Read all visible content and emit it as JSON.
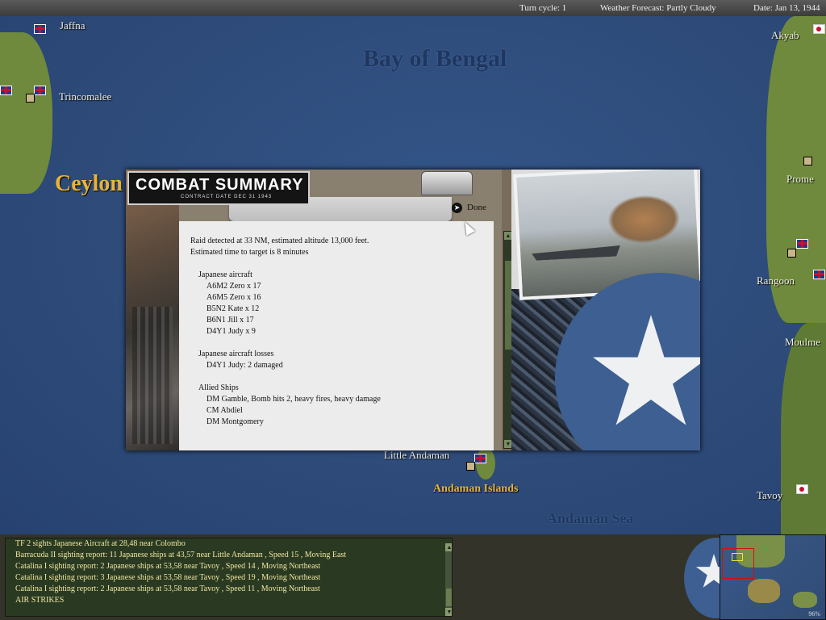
{
  "topbar": {
    "turn_cycle": "Turn cycle: 1",
    "weather": "Weather Forecast: Partly Cloudy",
    "date": "Date: Jan 13, 1944"
  },
  "map": {
    "sea_labels": {
      "bay_of_bengal": "Bay of Bengal",
      "andaman_sea": "Andaman Sea"
    },
    "places": {
      "jaffna": "Jaffna",
      "trincomalee": "Trincomalee",
      "ceylon": "Ceylon",
      "akyab": "Akyab",
      "prome": "Prome",
      "rangoon": "Rangoon",
      "moulmein": "Moulme",
      "tavoy": "Tavoy",
      "little_andaman": "Little Andaman",
      "andaman_islands": "Andaman Islands"
    }
  },
  "dialog": {
    "title": "COMBAT SUMMARY",
    "subtitle": "CONTRACT DATE DEC 31 1943",
    "done_label": "Done",
    "report": {
      "raid_line1": "Raid detected at 33 NM, estimated altitude 13,000 feet.",
      "raid_line2": "Estimated time to target is 8 minutes",
      "aircraft_header": "Japanese aircraft",
      "aircraft": [
        "A6M2 Zero x 17",
        "A6M5 Zero x 16",
        "B5N2 Kate x 12",
        "B6N1 Jill x 17",
        "D4Y1 Judy x 9"
      ],
      "losses_header": "Japanese aircraft losses",
      "losses": [
        "D4Y1 Judy: 2 damaged"
      ],
      "ships_header": "Allied Ships",
      "ships": [
        "DM Gamble, Bomb hits 2,  heavy fires,  heavy damage",
        "CM Abdiel",
        "DM Montgomery"
      ]
    }
  },
  "log": {
    "messages": [
      "TF 2 sights Japanese Aircraft at 28,48 near Colombo",
      "Barracuda II sighting report: 11 Japanese ships at 43,57 near Little Andaman , Speed 15 , Moving East",
      "Catalina I sighting report: 2 Japanese ships at 53,58 near Tavoy , Speed 14 , Moving Northeast",
      "Catalina I sighting report: 3 Japanese ships at 53,58 near Tavoy , Speed 19 , Moving Northeast",
      "Catalina I sighting report: 2 Japanese ships at 53,58 near Tavoy , Speed 11 , Moving Northeast",
      "AIR STRIKES"
    ]
  },
  "minimap": {
    "zoom_label": "96%"
  }
}
